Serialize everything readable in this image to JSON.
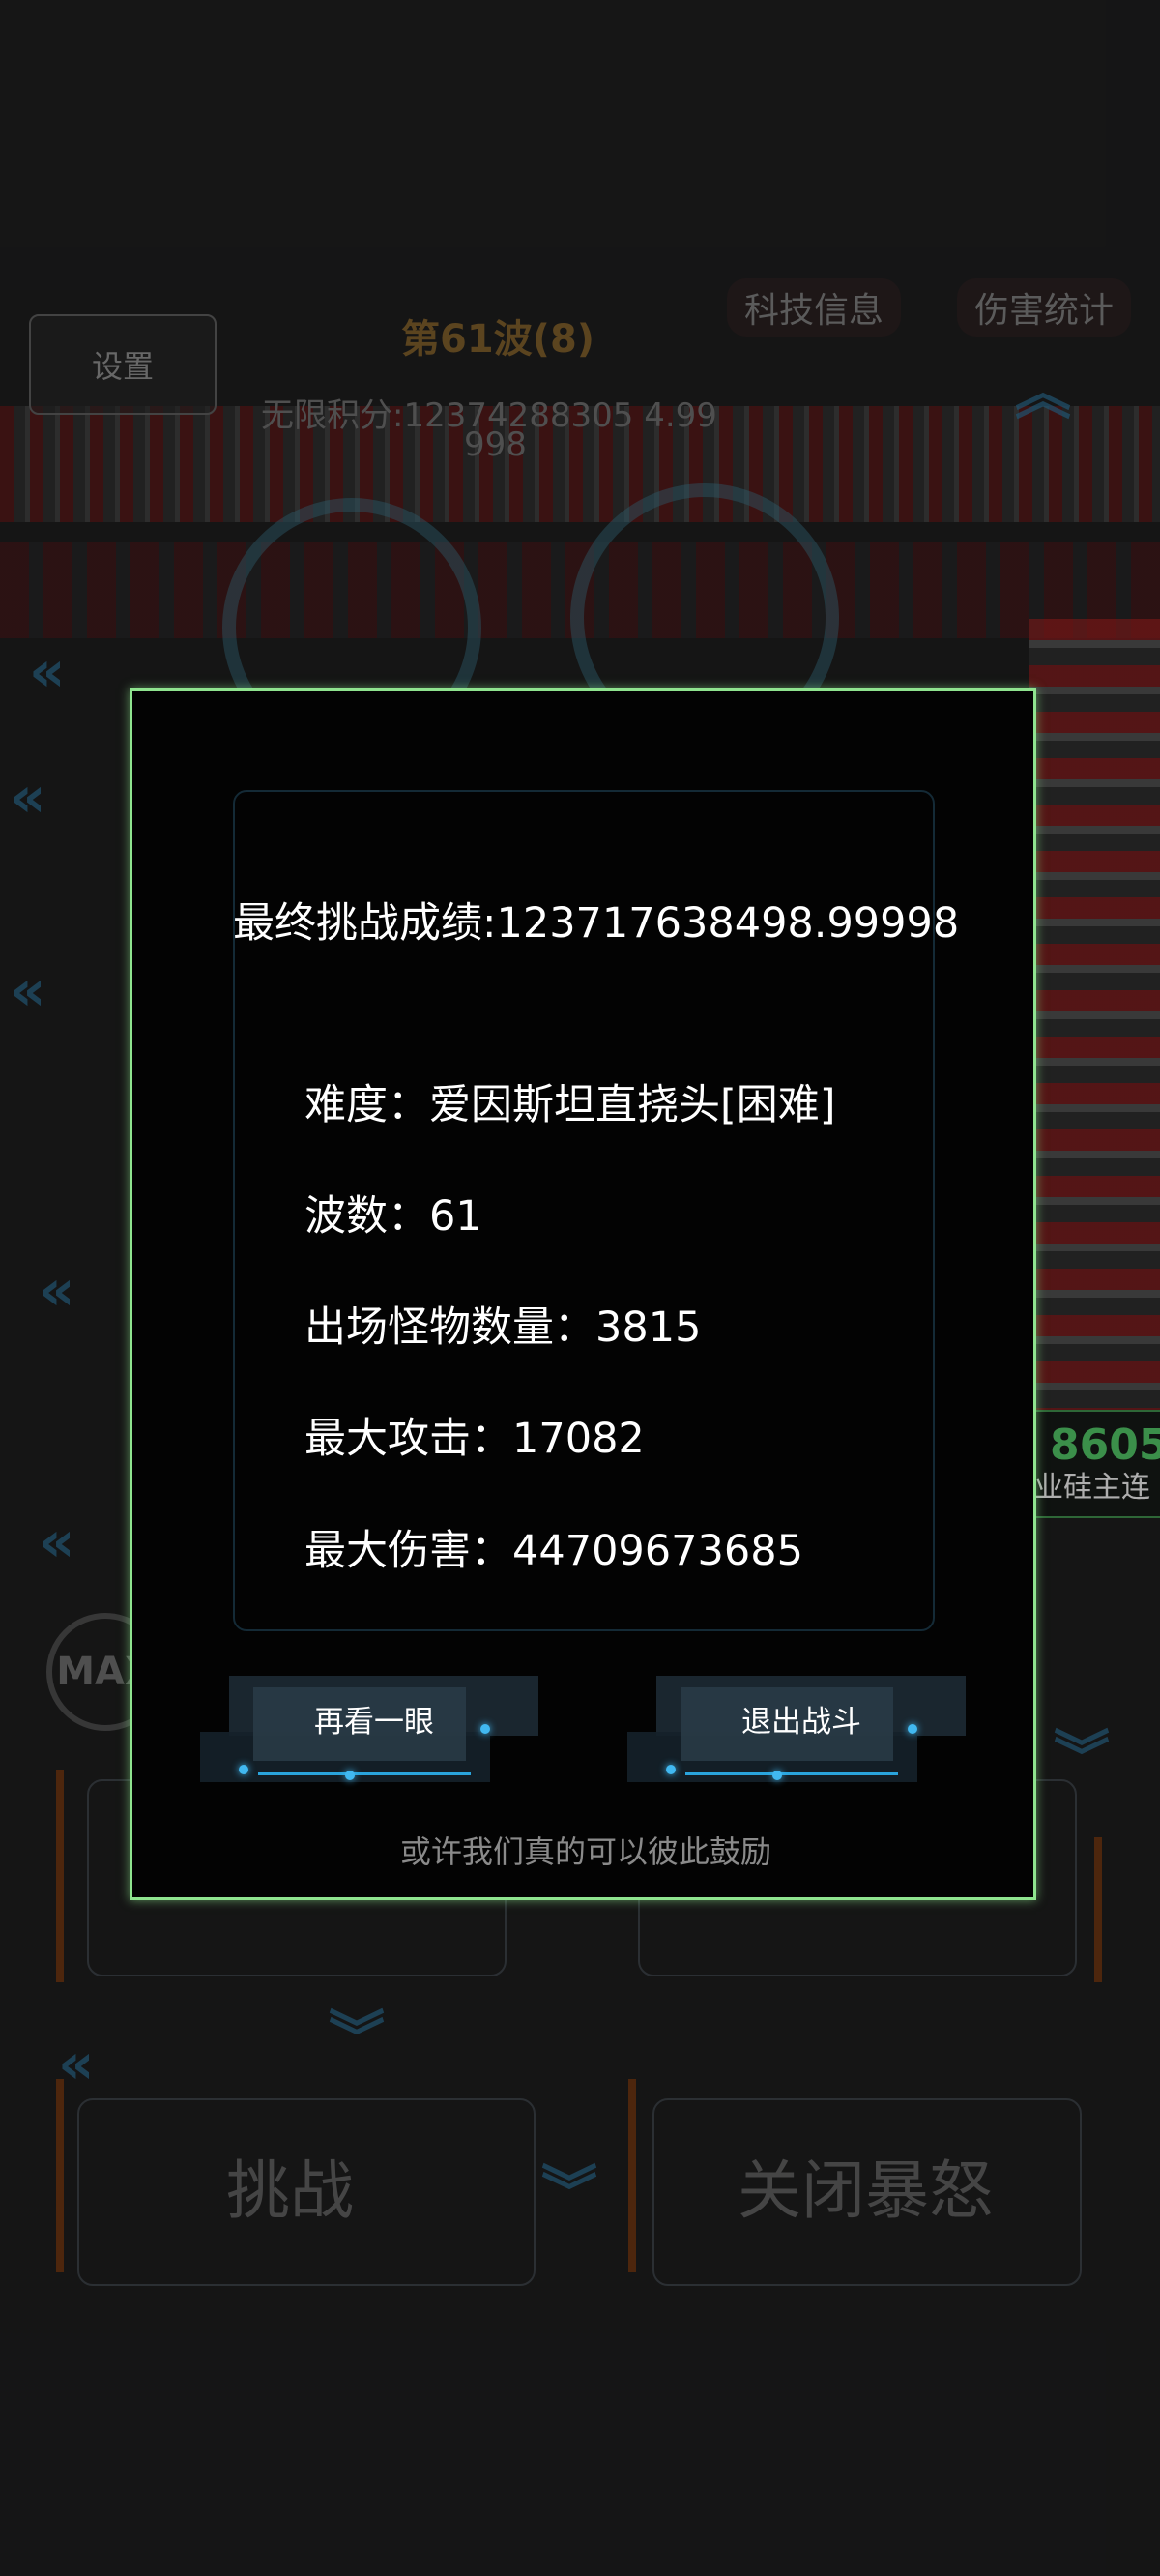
{
  "hud": {
    "settings_label": "设置",
    "wave_label": "第61波(8)",
    "score_label": "无限积分:12374288305 4.99",
    "score_label_cont": "998",
    "tab_tech": "科技信息",
    "tab_damage": "伤害统计",
    "max_badge": "MAX",
    "challenge_button": "挑战",
    "close_rage_button": "关闭暴怒"
  },
  "side_notification": {
    "number": "8605",
    "text": "工业硅主连"
  },
  "result_modal": {
    "final_score": "最终挑战成绩:123717638498.99998",
    "difficulty": "难度：爱因斯坦直挠头[困难]",
    "waves": "波数：61",
    "monster_count": "出场怪物数量：3815",
    "max_attack": "最大攻击：17082",
    "max_damage": "最大伤害：44709673685",
    "btn_again": "再看一眼",
    "btn_exit": "退出战斗",
    "footer": "或许我们真的可以彼此鼓励"
  },
  "colors": {
    "modal_border": "#8fe48f",
    "accent_blue": "#41b8f0",
    "notif_green": "#4fbf63"
  }
}
